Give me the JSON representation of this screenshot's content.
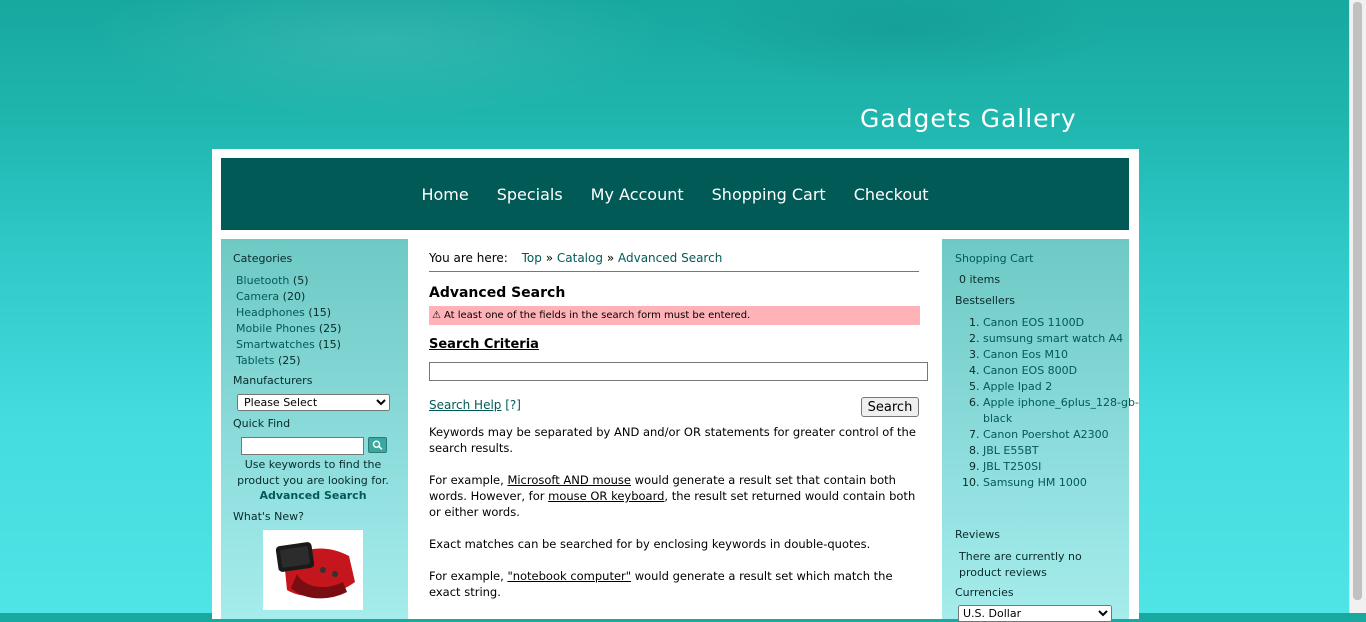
{
  "site": {
    "title": "Gadgets Gallery"
  },
  "nav": [
    "Home",
    "Specials",
    "My Account",
    "Shopping Cart",
    "Checkout"
  ],
  "left": {
    "categories_title": "Categories",
    "categories": [
      {
        "name": "Bluetooth",
        "count": "(5)"
      },
      {
        "name": "Camera",
        "count": "(20)"
      },
      {
        "name": "Headphones",
        "count": "(15)"
      },
      {
        "name": "Mobile Phones",
        "count": "(25)"
      },
      {
        "name": "Smartwatches",
        "count": "(15)"
      },
      {
        "name": "Tablets",
        "count": "(25)"
      }
    ],
    "manufacturers_title": "Manufacturers",
    "manufacturers_selected": "Please Select",
    "quickfind_title": "Quick Find",
    "quickfind_text": "Use keywords to find the product you are looking for.",
    "advanced_link": "Advanced Search",
    "whatsnew_title": "What's New?"
  },
  "main": {
    "breadcrumb_label": "You are here:",
    "breadcrumb": [
      "Top",
      "Catalog",
      "Advanced Search"
    ],
    "title": "Advanced Search",
    "error": "At least one of the fields in the search form must be entered.",
    "criteria_title": "Search Criteria",
    "keywords_value": "",
    "search_help": "Search Help",
    "search_help_q": "[?]",
    "search_button": "Search",
    "help_p1": "Keywords may be separated by AND and/or OR statements for greater control of the search results.",
    "help_p2_a": "For example, ",
    "help_p2_ex1": "Microsoft AND mouse",
    "help_p2_b": " would generate a result set that contain both words. However, for ",
    "help_p2_ex2": "mouse OR keyboard",
    "help_p2_c": ", the result set returned would contain both or either words.",
    "help_p3": "Exact matches can be searched for by enclosing keywords in double-quotes.",
    "help_p4_a": "For example, ",
    "help_p4_ex": "\"notebook computer\"",
    "help_p4_b": " would generate a result set which match the exact string."
  },
  "right": {
    "cart_title": "Shopping Cart",
    "cart_items": "0 items",
    "bestsellers_title": "Bestsellers",
    "bestsellers": [
      "Canon EOS 1100D",
      "sumsung smart watch A4",
      "Canon Eos M10",
      "Canon EOS 800D",
      "Apple Ipad 2",
      "Apple iphone_6plus_128-gb-black",
      "Canon Poershot A2300",
      "JBL E55BT",
      "JBL T250SI",
      "Samsung HM 1000"
    ],
    "reviews_title": "Reviews",
    "reviews_text": "There are currently no product reviews",
    "currencies_title": "Currencies",
    "currency_selected": "U.S. Dollar"
  },
  "colors": {
    "nav_bg": "#025a57",
    "accent": "#025a57",
    "error_bg": "#ffb3b8"
  }
}
